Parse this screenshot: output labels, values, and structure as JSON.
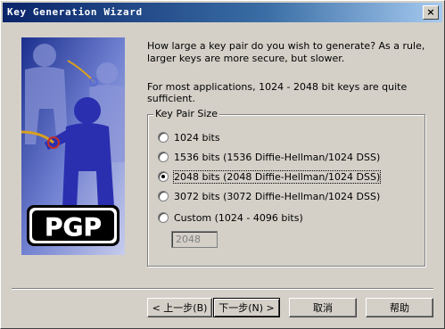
{
  "window": {
    "title": "Key Generation Wizard"
  },
  "art": {
    "logo_text": "PGP"
  },
  "main": {
    "question": "How large a key pair do you wish to generate?  As a rule, larger keys are more secure, but slower.",
    "info": "For most applications, 1024 - 2048 bit keys are quite sufficient."
  },
  "keysize": {
    "legend": "Key Pair Size",
    "options": [
      {
        "label": "1024 bits",
        "selected": false
      },
      {
        "label": "1536 bits (1536 Diffie-Hellman/1024 DSS)",
        "selected": false
      },
      {
        "label": "2048 bits (2048 Diffie-Hellman/1024 DSS)",
        "selected": true
      },
      {
        "label": "3072 bits (3072 Diffie-Hellman/1024 DSS)",
        "selected": false
      },
      {
        "label": "Custom (1024 - 4096 bits)",
        "selected": false
      }
    ],
    "custom_value": "2048"
  },
  "buttons": {
    "back": "< 上一步(B)",
    "next": "下一步(N) >",
    "cancel": "取消",
    "help": "帮助"
  },
  "colors": {
    "titlebar_start": "#0a246a",
    "titlebar_end": "#a6caf0",
    "dialog_bg": "#d4d0c8"
  }
}
